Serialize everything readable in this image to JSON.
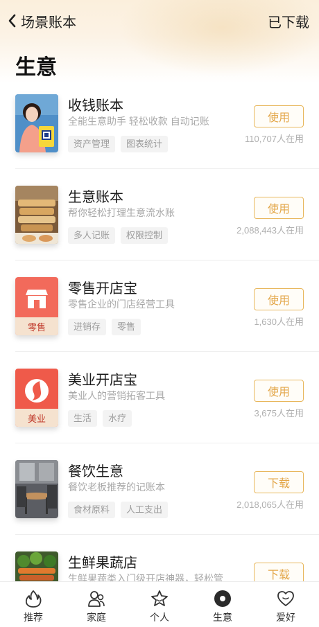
{
  "nav": {
    "title": "场景账本",
    "right_label": "已下载"
  },
  "section_title": "生意",
  "items": [
    {
      "name": "收钱账本",
      "desc": "全能生意助手 轻松收款 自动记账",
      "tags": [
        "资产管理",
        "图表统计"
      ],
      "button": "使用",
      "users": "110,707人在用",
      "thumb": "photo-woman-qr"
    },
    {
      "name": "生意账本",
      "desc": "帮你轻松打理生意流水账",
      "tags": [
        "多人记账",
        "权限控制"
      ],
      "button": "使用",
      "users": "2,088,443人在用",
      "thumb": "photo-food-stall"
    },
    {
      "name": "零售开店宝",
      "desc": "零售企业的门店经营工具",
      "tags": [
        "进销存",
        "零售"
      ],
      "button": "使用",
      "users": "1,630人在用",
      "thumb": "shop-icon",
      "thumb_label": "零售"
    },
    {
      "name": "美业开店宝",
      "desc": "美业人的营销拓客工具",
      "tags": [
        "生活",
        "水疗"
      ],
      "button": "使用",
      "users": "3,675人在用",
      "thumb": "beauty-icon",
      "thumb_label": "美业"
    },
    {
      "name": "餐饮生意",
      "desc": "餐饮老板推荐的记账本",
      "tags": [
        "食材原料",
        "人工支出"
      ],
      "button": "下载",
      "users": "2,018,065人在用",
      "thumb": "photo-restaurant"
    },
    {
      "name": "生鲜果蔬店",
      "desc": "生鲜果蔬类入门级开店神器，轻松管",
      "tags": [],
      "button": "下载",
      "users": "",
      "thumb": "photo-produce"
    }
  ],
  "tabs": [
    {
      "label": "推荐",
      "icon": "flame-icon"
    },
    {
      "label": "家庭",
      "icon": "family-icon"
    },
    {
      "label": "个人",
      "icon": "star-face-icon"
    },
    {
      "label": "生意",
      "icon": "business-dot-icon",
      "active": true
    },
    {
      "label": "爱好",
      "icon": "heart-icon"
    }
  ],
  "colors": {
    "accent": "#e3a648",
    "retail_red": "#f05a4f",
    "beauty_red": "#ef5a4a"
  }
}
